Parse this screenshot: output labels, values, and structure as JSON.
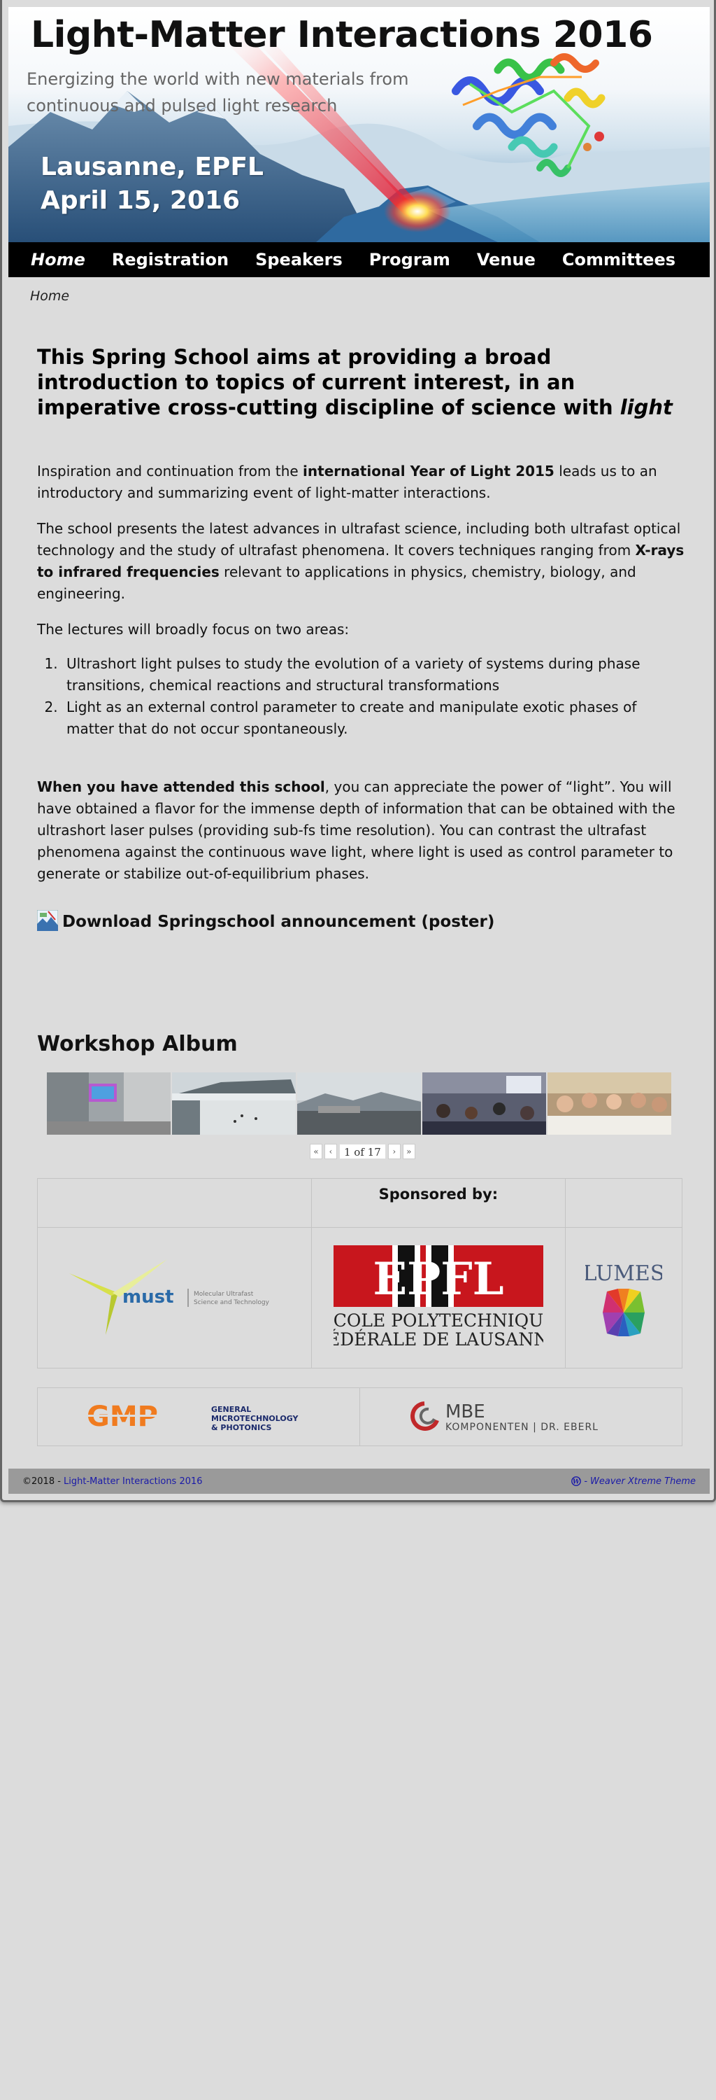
{
  "site": {
    "title": "Light-Matter Interactions 2016",
    "tagline": "Energizing the world with new materials from continuous and pulsed light research",
    "banner_location": "Lausanne, EPFL",
    "banner_date": "April 15, 2016"
  },
  "nav": {
    "items": [
      {
        "label": "Home",
        "active": true
      },
      {
        "label": "Registration"
      },
      {
        "label": "Speakers"
      },
      {
        "label": "Program"
      },
      {
        "label": "Venue"
      },
      {
        "label": "Committees"
      }
    ]
  },
  "breadcrumb": "Home",
  "content": {
    "heading_pre": "This Spring School aims at providing a broad introduction to topics of current interest, in an imperative cross-cutting discipline of science with ",
    "heading_em": "light",
    "p1_pre": "Inspiration and continuation from the ",
    "p1_bold": "international Year of Light 2015",
    "p1_post": " leads us to an introductory and summarizing event of light-matter interactions.",
    "p2_pre": "The school presents the latest advances in ultrafast science, including both ultrafast optical technology and the study of ultrafast phenomena. It covers techniques ranging from ",
    "p2_bold": "X-rays to infrared frequencies",
    "p2_post": " relevant to applications in physics, chemistry, biology, and engineering.",
    "p3": "The lectures will broadly focus on two areas:",
    "areas": [
      "Ultrashort light pulses to study the evolution of a variety of systems during phase transitions, chemical reactions and structural transformations",
      "Light as an external control parameter to create and manipulate exotic phases of matter that do not occur spontaneously."
    ],
    "p4_bold": "When you have attended this school",
    "p4_post": ", you can appreciate the power of “light”. You will have obtained a flavor for the immense depth of information that can be obtained with the ultrashort laser pulses (providing sub-fs time resolution). You can contrast the ultrafast phenomena against the continuous wave light, where light is used as control parameter to generate or stabilize out-of-equilibrium phases.",
    "download_label": "Download Springschool announcement (poster)"
  },
  "album": {
    "title": "Workshop Album",
    "pager": {
      "first": "«",
      "prev": "‹",
      "text": "1 of 17",
      "next": "›",
      "last": "»"
    }
  },
  "sponsors": {
    "heading": "Sponsored by:",
    "must": {
      "name": "must",
      "sub1": "Molecular Ultrafast",
      "sub2": "Science and Technology"
    },
    "epfl": {
      "logo": "EPFL",
      "line1": "ÉCOLE POLYTECHNIQUE",
      "line2": "FÉDÉRALE DE LAUSANNE"
    },
    "lumes": {
      "name": "LUMES"
    },
    "gmp": {
      "name": "GMP",
      "line1": "GENERAL",
      "line2": "MICROTECHNOLOGY",
      "line3": "& PHOTONICS"
    },
    "mbe": {
      "name": "MBE",
      "line1": "KOMPONENTEN | DR. EBERL"
    }
  },
  "footer": {
    "copyright_prefix": "©2018 - ",
    "copyright_link": "Light-Matter Interactions 2016",
    "theme_sep": "- ",
    "theme": "Weaver Xtreme Theme"
  },
  "colors": {
    "nav_bg": "#000000",
    "footer_bg": "#9a9a9a",
    "link": "#1a1aa8",
    "epfl_red": "#c8161d",
    "gmp_orange": "#f07b1f",
    "gmp_navy": "#1b2a6b"
  }
}
